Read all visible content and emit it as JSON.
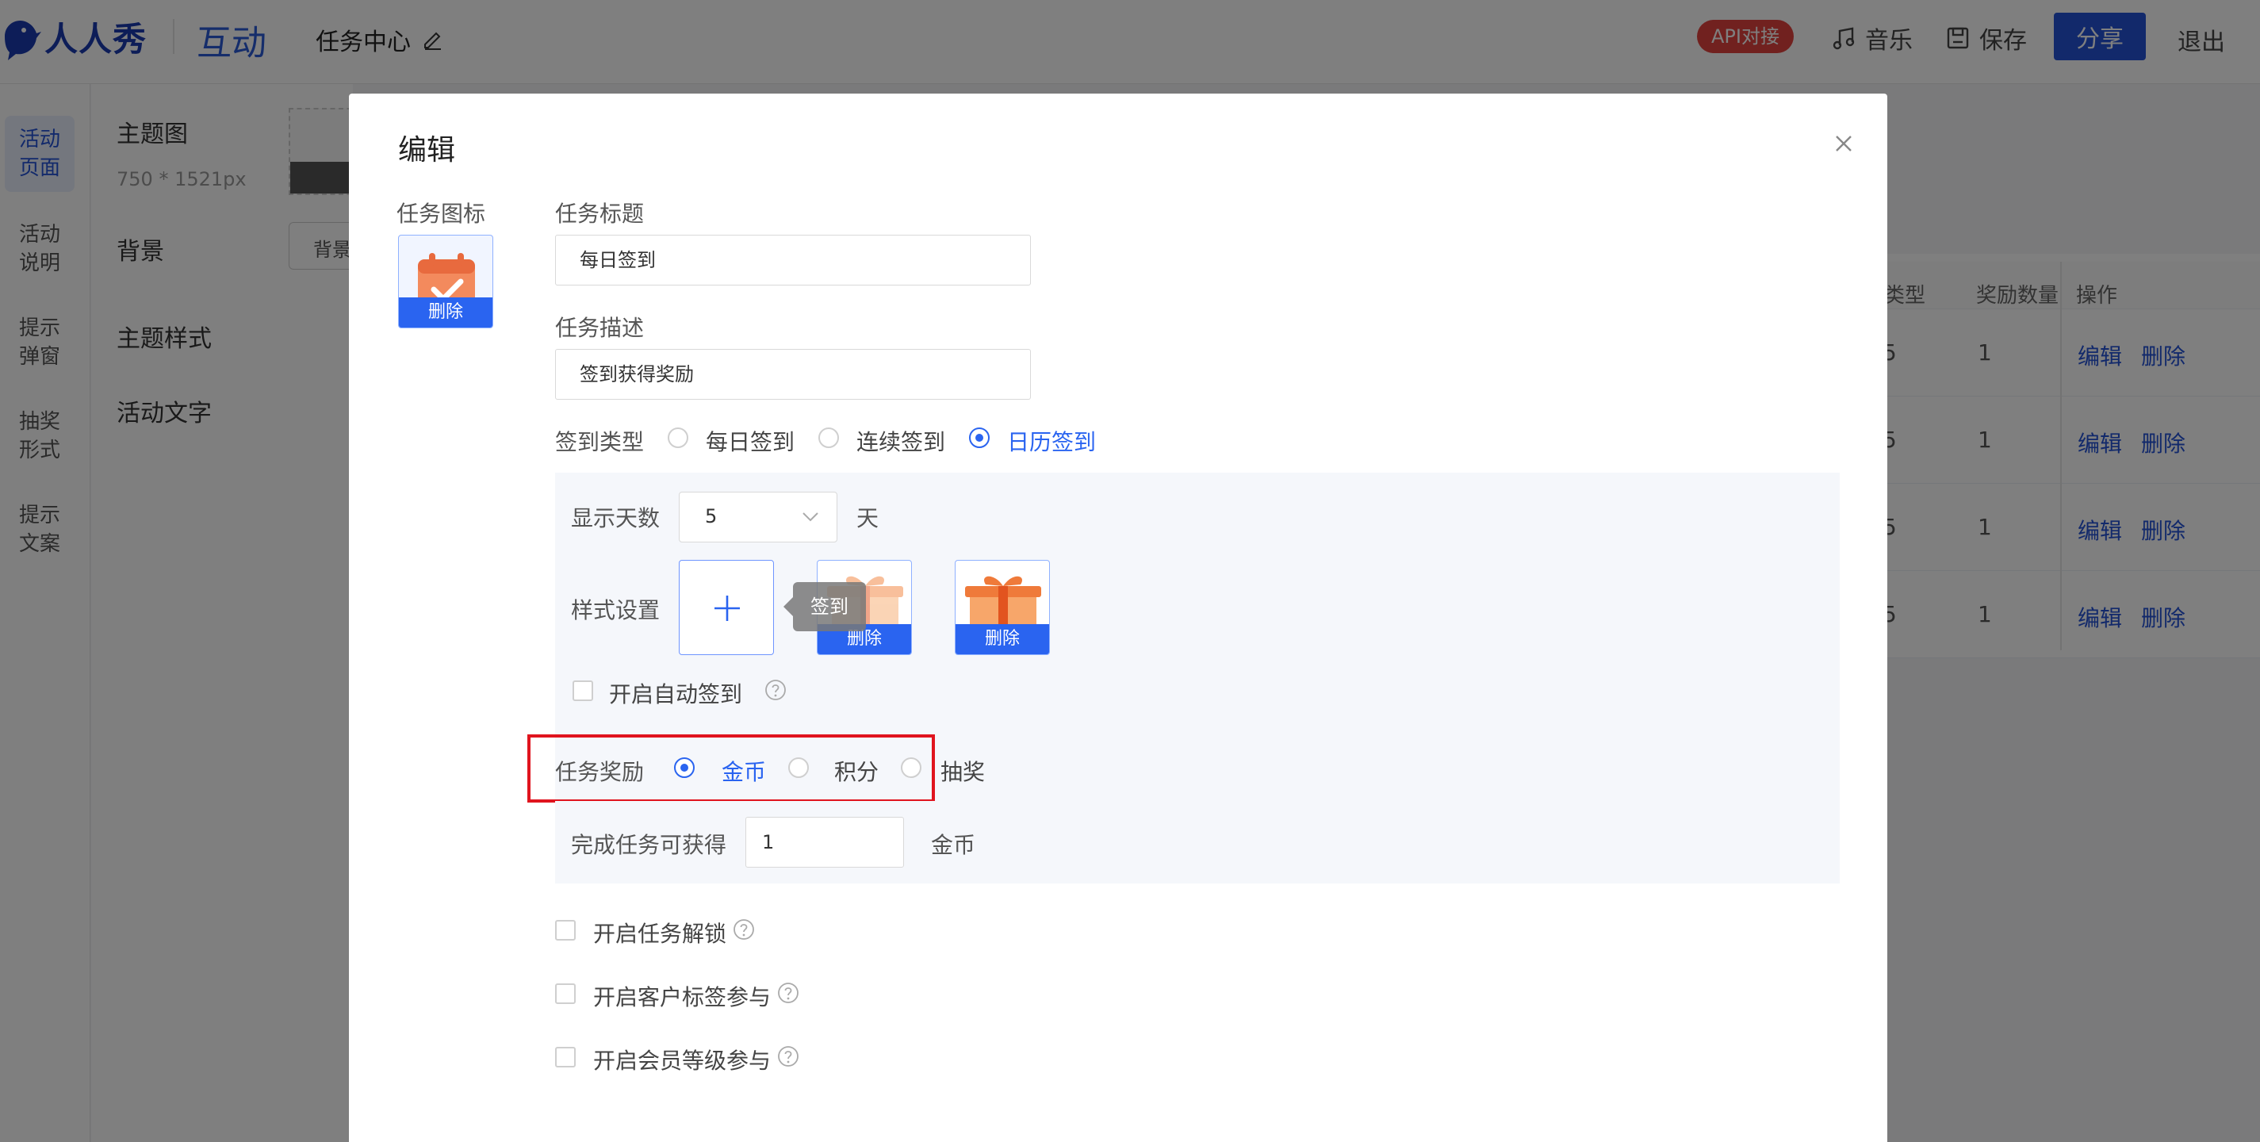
{
  "header": {
    "logo_text": "人人秀",
    "module": "互动",
    "page_title": "任务中心",
    "api_badge": "API对接",
    "music": "音乐",
    "save": "保存",
    "share": "分享",
    "exit": "退出"
  },
  "left_nav": [
    {
      "label": "活动\n页面",
      "active": true
    },
    {
      "label": "活动\n说明"
    },
    {
      "label": "提示\n弹窗"
    },
    {
      "label": "抽奖\n形式"
    },
    {
      "label": "提示\n文案"
    }
  ],
  "settings": {
    "theme_image": "主题图",
    "theme_size": "750 * 1521px",
    "background": "背景",
    "background_btn": "背景",
    "theme_style": "主题样式",
    "activity_text": "活动文字"
  },
  "bg_table": {
    "headers": [
      "类型",
      "奖励数量",
      "操作"
    ],
    "rows": [
      {
        "frag": "5",
        "qty": "1",
        "edit": "编辑",
        "delete": "删除"
      },
      {
        "frag": "5",
        "qty": "1",
        "edit": "编辑",
        "delete": "删除"
      },
      {
        "frag": "5",
        "qty": "1",
        "edit": "编辑",
        "delete": "删除"
      },
      {
        "frag": "5",
        "qty": "1",
        "edit": "编辑",
        "delete": "删除"
      }
    ]
  },
  "modal": {
    "title": "编辑",
    "task_icon_label": "任务图标",
    "task_icon_delete": "删除",
    "task_title_label": "任务标题",
    "task_title_value": "每日签到",
    "task_desc_label": "任务描述",
    "task_desc_value": "签到获得奖励",
    "signin_type_label": "签到类型",
    "signin_options": [
      "每日签到",
      "连续签到",
      "日历签到"
    ],
    "signin_selected": "日历签到",
    "display_days_label": "显示天数",
    "display_days_value": "5",
    "display_days_unit": "天",
    "style_label": "样式设置",
    "tooltip": "签到",
    "gift_delete": "删除",
    "auto_signin": "开启自动签到",
    "reward_label": "任务奖励",
    "reward_options": [
      "金币",
      "积分",
      "抽奖"
    ],
    "reward_selected": "金币",
    "complete_label": "完成任务可获得",
    "complete_value": "1",
    "complete_unit": "金币",
    "unlock": "开启任务解锁",
    "customer_tag": "开启客户标签参与",
    "member_level": "开启会员等级参与"
  },
  "colors": {
    "accent": "#2a64f0",
    "brand_dark": "#1a3bb0",
    "highlight": "#e0141e",
    "badge": "#e2433e"
  }
}
